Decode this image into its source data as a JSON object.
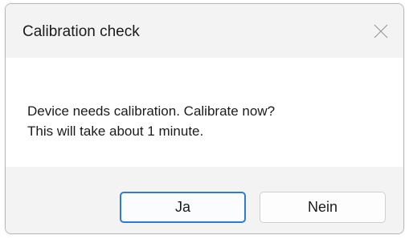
{
  "dialog": {
    "title": "Calibration check",
    "message_line1": "Device needs calibration. Calibrate now?",
    "message_line2": "This will take about 1 minute.",
    "buttons": {
      "yes_label": "Ja",
      "no_label": "Nein"
    },
    "icons": {
      "close": "close-icon"
    },
    "colors": {
      "accent": "#2f7bd1",
      "titlebar_bg": "#f3f3f3",
      "footer_bg": "#f3f3f3",
      "content_bg": "#ffffff"
    }
  }
}
